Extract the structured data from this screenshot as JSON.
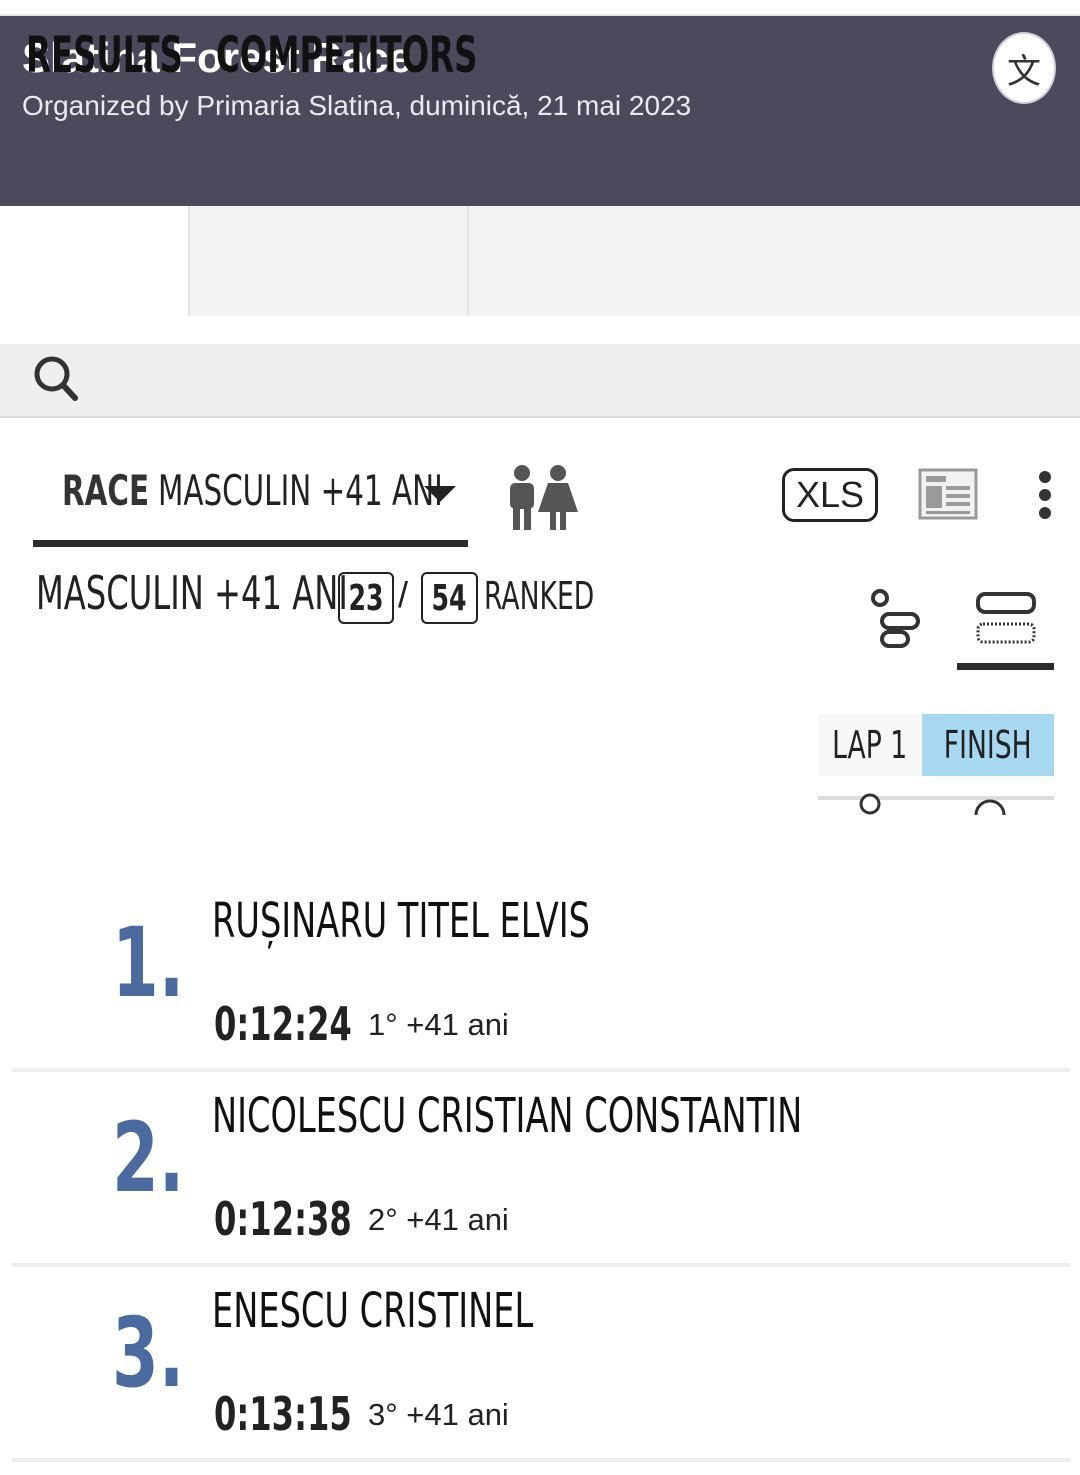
{
  "header": {
    "title": "Slatina Forest Race",
    "subtitle": "Organized by Primaria Slatina, duminică, 21 mai 2023",
    "translate_icon": "translate-icon",
    "translate_glyph": "文"
  },
  "tabs": [
    {
      "label": "RESULTS",
      "active": true
    },
    {
      "label": "COMPETITORS",
      "active": false
    }
  ],
  "search": {
    "icon": "search-icon"
  },
  "filter": {
    "race_label": "RACE",
    "race_value": "MASCULIN +41 ANI",
    "xls_label": "XLS"
  },
  "category": {
    "name": "MASCULIN +41 ANI",
    "ranked_count": "23",
    "total_count": "54",
    "slash": "/",
    "ranked_label": "RANKED"
  },
  "split_selector": {
    "options": [
      "LAP 1",
      "FINISH"
    ],
    "selected": "FINISH",
    "selected_color": "#a6d9f1"
  },
  "results": [
    {
      "rank": "1.",
      "name": "RUȘINARU TITEL ELVIS",
      "time": "0:12:24",
      "category_rank": "1° +41 ani"
    },
    {
      "rank": "2.",
      "name": "NICOLESCU CRISTIAN CONSTANTIN",
      "time": "0:12:38",
      "category_rank": "2° +41 ani"
    },
    {
      "rank": "3.",
      "name": "ENESCU CRISTINEL",
      "time": "0:13:15",
      "category_rank": "3° +41 ani"
    }
  ],
  "colors": {
    "header_bg": "#4b4a5c",
    "rank_color": "#4a6aa0",
    "accent_selected": "#a6d9f1"
  }
}
